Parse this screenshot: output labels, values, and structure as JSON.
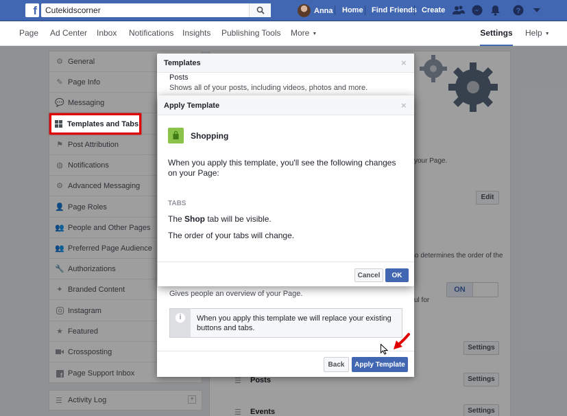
{
  "topbar": {
    "search_value": "Cutekidscorner",
    "user_name": "Anna",
    "links": [
      "Home",
      "Find Friends",
      "Create"
    ]
  },
  "pagenav": {
    "items": [
      "Page",
      "Ad Center",
      "Inbox",
      "Notifications",
      "Insights",
      "Publishing Tools",
      "More"
    ],
    "settings": "Settings",
    "help": "Help"
  },
  "sidebar": {
    "items": [
      {
        "label": "General",
        "icon": "gear-icon"
      },
      {
        "label": "Page Info",
        "icon": "pencil-icon"
      },
      {
        "label": "Messaging",
        "icon": "chat-icon"
      },
      {
        "label": "Templates and Tabs",
        "icon": "grid-icon"
      },
      {
        "label": "Post Attribution",
        "icon": "flag-icon"
      },
      {
        "label": "Notifications",
        "icon": "globe-icon"
      },
      {
        "label": "Advanced Messaging",
        "icon": "chat-gear-icon"
      },
      {
        "label": "Page Roles",
        "icon": "person-icon"
      },
      {
        "label": "People and Other Pages",
        "icon": "people-icon"
      },
      {
        "label": "Preferred Page Audience",
        "icon": "audience-icon"
      },
      {
        "label": "Authorizations",
        "icon": "wrench-icon"
      },
      {
        "label": "Branded Content",
        "icon": "handshake-icon"
      },
      {
        "label": "Instagram",
        "icon": "instagram-icon"
      },
      {
        "label": "Featured",
        "icon": "star-icon"
      },
      {
        "label": "Crossposting",
        "icon": "video-icon"
      },
      {
        "label": "Page Support Inbox",
        "icon": "facebook-icon"
      }
    ],
    "activity_log": "Activity Log"
  },
  "content": {
    "frag_page": "your Page.",
    "edit_btn": "Edit",
    "frag_order": "so determines the order of the",
    "frag_for": "ul for",
    "toggle_on": "ON",
    "settings_btn": "Settings",
    "rows": [
      "Posts",
      "Events"
    ]
  },
  "templates_dialog": {
    "title": "Templates",
    "posts_title": "Posts",
    "posts_desc": "Shows all of your posts, including videos, photos and more.",
    "overview": "Gives people an overview of your Page.",
    "info_text": "When you apply this template we will replace your existing buttons and tabs.",
    "back_btn": "Back",
    "apply_btn": "Apply Template"
  },
  "apply_dialog": {
    "title": "Apply Template",
    "template_name": "Shopping",
    "description": "When you apply this template, you'll see the following changes on your Page:",
    "tabs_heading": "TABS",
    "line1_pre": "The ",
    "line1_bold": "Shop",
    "line1_post": " tab will be visible.",
    "line2": "The order of your tabs will change.",
    "cancel_btn": "Cancel",
    "ok_btn": "OK"
  },
  "colors": {
    "brand_blue": "#4267b2",
    "highlight_red": "#e00000",
    "shop_green": "#8bc34a"
  }
}
